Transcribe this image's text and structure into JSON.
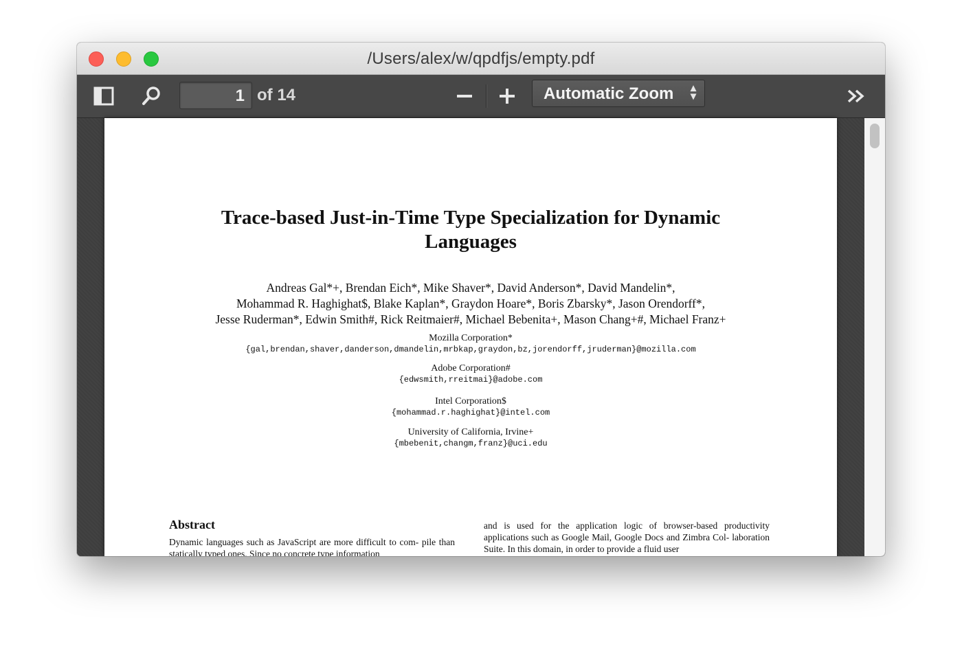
{
  "window": {
    "title": "/Users/alex/w/qpdfjs/empty.pdf"
  },
  "toolbar": {
    "sidebar_toggle_icon": "sidebar-icon",
    "search_icon": "search-icon",
    "page_number": "1",
    "page_count": "of 14",
    "zoom_out_icon": "minus-icon",
    "zoom_in_icon": "plus-icon",
    "zoom_value": "Automatic Zoom",
    "more_tools_icon": "double-chevron-right-icon"
  },
  "document": {
    "title_line1": "Trace-based Just-in-Time Type Specialization for Dynamic",
    "title_line2": "Languages",
    "authors_line1": "Andreas Gal*+, Brendan Eich*, Mike Shaver*, David Anderson*, David Mandelin*,",
    "authors_line2": "Mohammad R. Haghighat$, Blake Kaplan*, Graydon Hoare*, Boris Zbarsky*, Jason Orendorff*,",
    "authors_line3": "Jesse Ruderman*, Edwin Smith#, Rick Reitmaier#, Michael Bebenita+, Mason Chang+#, Michael Franz+",
    "affiliations": [
      {
        "name": "Mozilla Corporation*",
        "emails": "{gal,brendan,shaver,danderson,dmandelin,mrbkap,graydon,bz,jorendorff,jruderman}@mozilla.com"
      },
      {
        "name": "Adobe Corporation#",
        "emails": "{edwsmith,rreitmai}@adobe.com"
      },
      {
        "name": "Intel Corporation$",
        "emails": "{mohammad.r.haghighat}@intel.com"
      },
      {
        "name": "University of California, Irvine+",
        "emails": "{mbebenit,changm,franz}@uci.edu"
      }
    ],
    "abstract_heading": "Abstract",
    "abstract_left": "Dynamic languages such as JavaScript are more difficult to com- pile than statically typed ones. Since no concrete type information",
    "abstract_right": "and is used for the application logic of browser-based productivity applications such as Google Mail, Google Docs and Zimbra Col- laboration Suite. In this domain, in order to provide a fluid user"
  },
  "colors": {
    "toolbar_bg": "#474747",
    "viewer_bg": "#3f3f3f",
    "close": "#fc5f57",
    "minimize": "#fdbc2f",
    "maximize": "#29c840"
  }
}
